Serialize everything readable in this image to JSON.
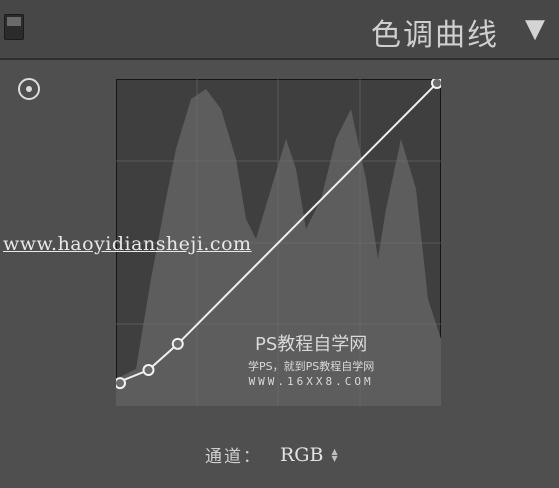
{
  "header": {
    "title": "色调曲线",
    "collapse_icon": "▼"
  },
  "curve": {
    "points": [
      [
        0,
        0.07
      ],
      [
        0.1,
        0.11
      ],
      [
        0.19,
        0.19
      ],
      [
        1.0,
        1.0
      ]
    ]
  },
  "watermarks": {
    "url": "www.haoyidiansheji.com",
    "ps_title": "PS教程自学网",
    "ps_sub": "学PS，就到PS教程自学网",
    "ps_url": "WWW.16XX8.COM"
  },
  "channel": {
    "label": "通道：",
    "value": "RGB"
  }
}
